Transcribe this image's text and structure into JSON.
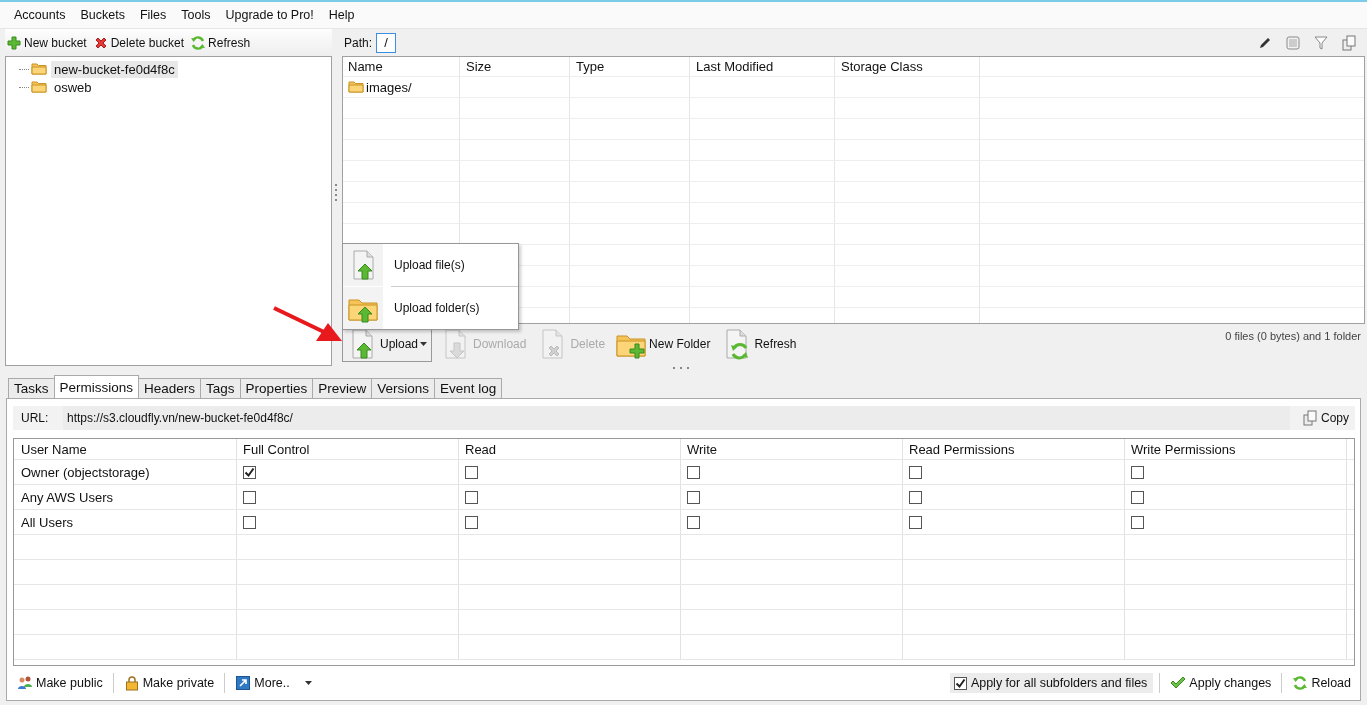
{
  "menu": [
    "Accounts",
    "Buckets",
    "Files",
    "Tools",
    "Upgrade to Pro!",
    "Help"
  ],
  "bucket_toolbar": [
    {
      "label": "New bucket",
      "kind": "plus"
    },
    {
      "label": "Delete bucket",
      "kind": "cross"
    },
    {
      "label": "Refresh",
      "kind": "refresh"
    }
  ],
  "buckets": [
    {
      "name": "new-bucket-fe0d4f8c",
      "selected": true
    },
    {
      "name": "osweb",
      "selected": false
    }
  ],
  "path": {
    "label": "Path:",
    "value": "/"
  },
  "files": {
    "columns": [
      "Name",
      "Size",
      "Type",
      "Last Modified",
      "Storage Class"
    ],
    "rows": [
      {
        "name": "images/",
        "kind": "folder"
      }
    ]
  },
  "upload_menu": [
    {
      "label": "Upload file(s)",
      "kind": "file-up"
    },
    {
      "label": "Upload folder(s)",
      "kind": "folder-up"
    }
  ],
  "file_actions": [
    {
      "label": "Upload",
      "kind": "file-up",
      "disabled": false,
      "dropdown": true
    },
    {
      "label": "Download",
      "kind": "file-down",
      "disabled": true,
      "dropdown": false
    },
    {
      "label": "Delete",
      "kind": "file-x",
      "disabled": true,
      "dropdown": false
    },
    {
      "label": "New Folder",
      "kind": "folder-plus",
      "disabled": false,
      "dropdown": false
    },
    {
      "label": "Refresh",
      "kind": "file-refresh",
      "disabled": false,
      "dropdown": false
    }
  ],
  "status": "0 files (0 bytes) and 1 folder",
  "tabs": [
    {
      "label": "Tasks",
      "selected": false
    },
    {
      "label": "Permissions",
      "selected": true
    },
    {
      "label": "Headers",
      "selected": false
    },
    {
      "label": "Tags",
      "selected": false
    },
    {
      "label": "Properties",
      "selected": false
    },
    {
      "label": "Preview",
      "selected": false
    },
    {
      "label": "Versions",
      "selected": false
    },
    {
      "label": "Event log",
      "selected": false
    }
  ],
  "url": {
    "label": "URL:",
    "value": "https://s3.cloudfly.vn/new-bucket-fe0d4f8c/",
    "button": "Copy"
  },
  "permissions": {
    "columns": [
      "User Name",
      "Full Control",
      "Read",
      "Write",
      "Read Permissions",
      "Write Permissions"
    ],
    "rows": [
      {
        "user": "Owner (objectstorage)",
        "grants": [
          true,
          false,
          false,
          false,
          false
        ]
      },
      {
        "user": "Any AWS Users",
        "grants": [
          false,
          false,
          false,
          false,
          false
        ]
      },
      {
        "user": "All Users",
        "grants": [
          false,
          false,
          false,
          false,
          false
        ]
      }
    ]
  },
  "left_actions": [
    {
      "label": "Make public",
      "kind": "people",
      "dropdown": false
    },
    {
      "label": "Make private",
      "kind": "lock",
      "dropdown": false
    },
    {
      "label": "More..",
      "kind": "external",
      "dropdown": true
    }
  ],
  "apply_all": {
    "label": "Apply for all subfolders and files",
    "checked": true
  },
  "right_actions": [
    {
      "label": "Apply changes",
      "kind": "check"
    },
    {
      "label": "Reload",
      "kind": "refresh"
    }
  ]
}
